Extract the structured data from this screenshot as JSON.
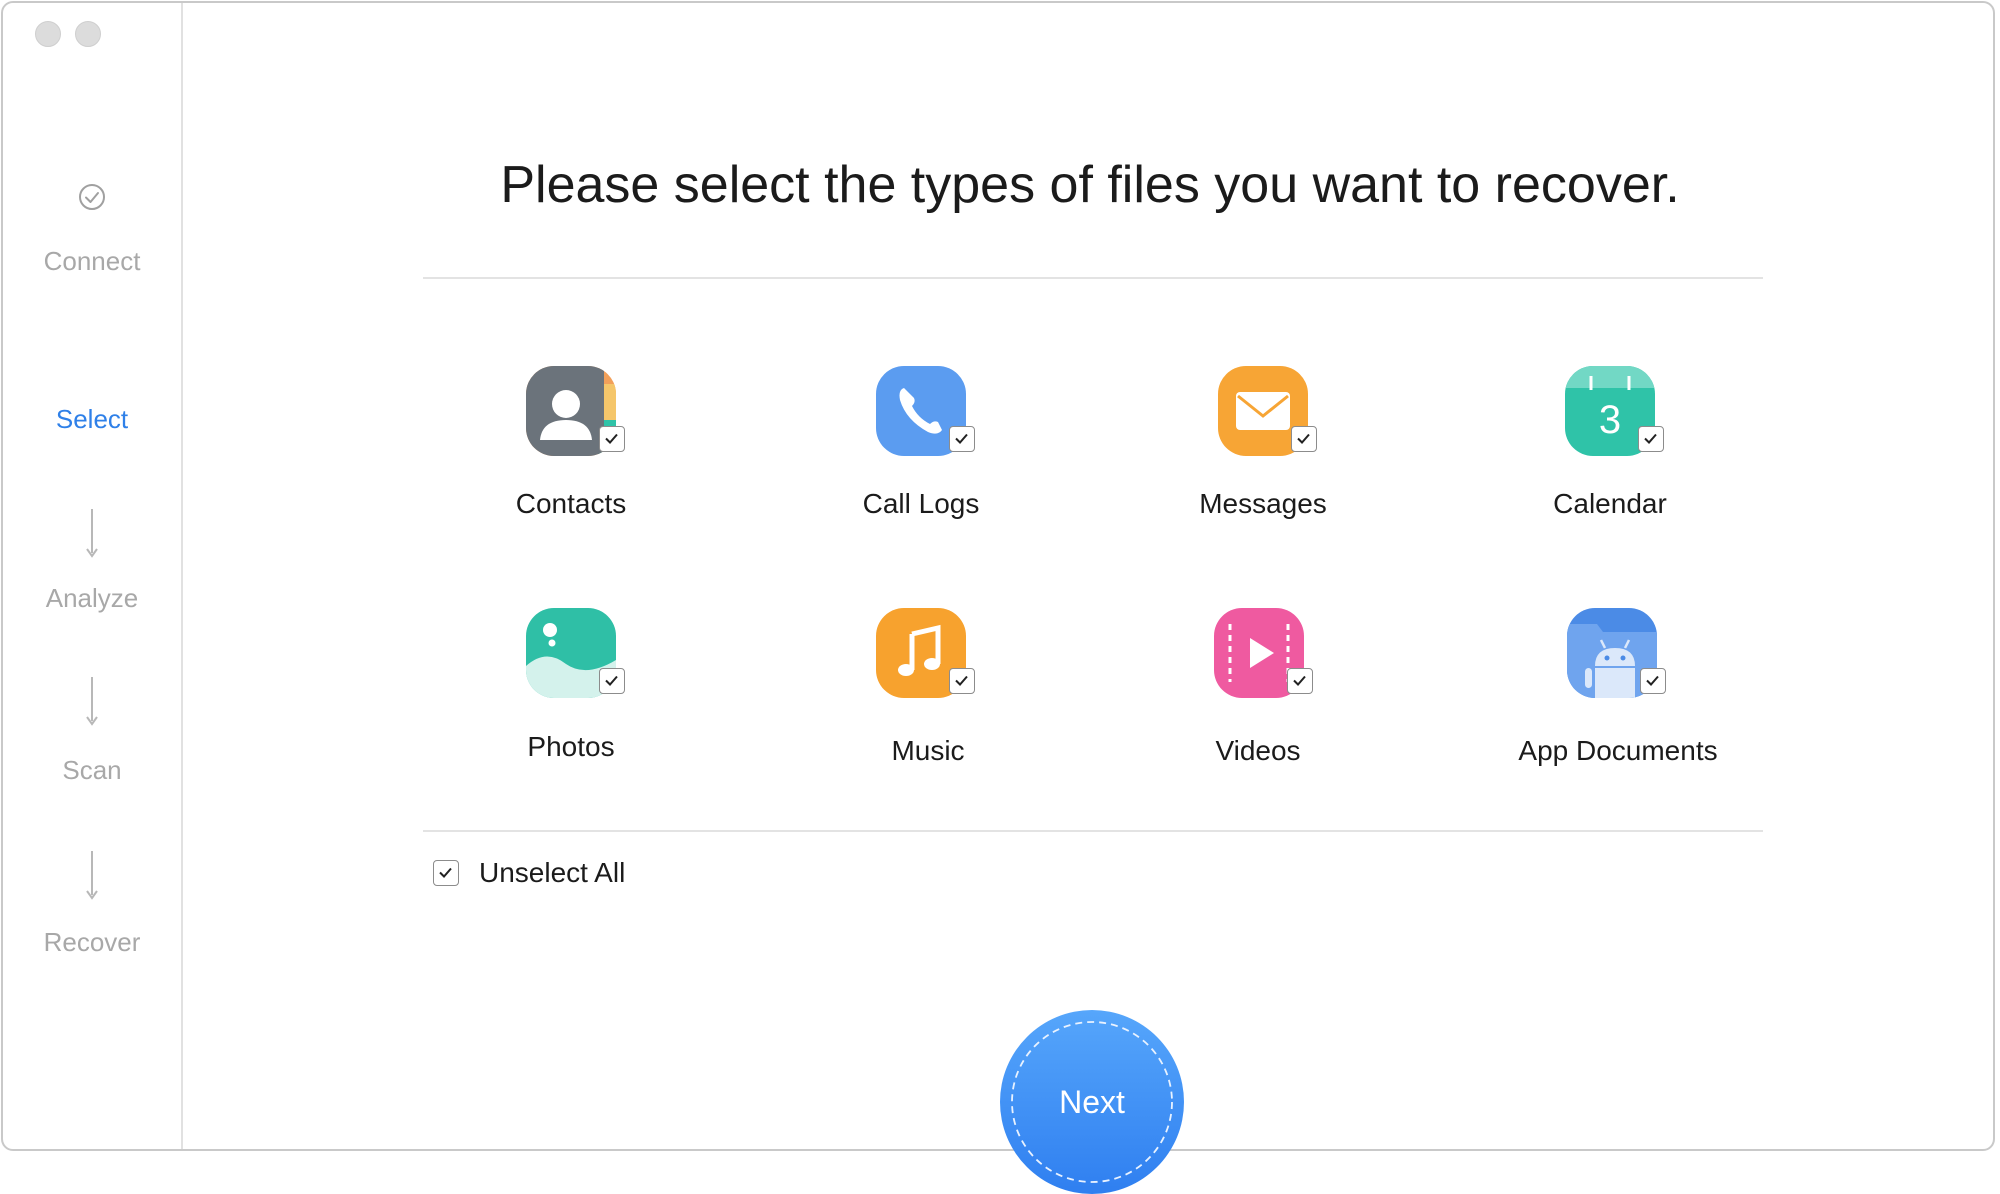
{
  "window": {
    "traffic_lights": [
      "close",
      "minimize"
    ]
  },
  "sidebar": {
    "steps": [
      {
        "label": "Connect",
        "state": "done",
        "icon": "check-circle-icon"
      },
      {
        "label": "Select",
        "state": "active"
      },
      {
        "label": "Analyze",
        "state": "pending",
        "icon": "arrow-down-icon"
      },
      {
        "label": "Scan",
        "state": "pending",
        "icon": "arrow-down-icon"
      },
      {
        "label": "Recover",
        "state": "pending",
        "icon": "arrow-down-icon"
      }
    ]
  },
  "main": {
    "title": "Please select the types of files you want to recover.",
    "file_types": [
      {
        "label": "Contacts",
        "icon": "contacts-icon",
        "checked": true
      },
      {
        "label": "Call Logs",
        "icon": "phone-icon",
        "checked": true
      },
      {
        "label": "Messages",
        "icon": "envelope-icon",
        "checked": true
      },
      {
        "label": "Calendar",
        "icon": "calendar-icon",
        "checked": true,
        "icon_text": "3"
      },
      {
        "label": "Photos",
        "icon": "photos-icon",
        "checked": true
      },
      {
        "label": "Music",
        "icon": "music-note-icon",
        "checked": true
      },
      {
        "label": "Videos",
        "icon": "play-icon",
        "checked": true
      },
      {
        "label": "App Documents",
        "icon": "android-icon",
        "checked": true
      }
    ],
    "unselect_all": {
      "label": "Unselect All",
      "checked": true
    },
    "next_button": {
      "label": "Next"
    }
  },
  "colors": {
    "accent": "#2f80e8",
    "inactive_text": "#a8a8a8",
    "next_button": "#3f8ff5",
    "contacts": "#6b737b",
    "call_logs": "#5b9cf0",
    "messages": "#f7a535",
    "calendar": "#2fc3a8",
    "photos": "#2fbfa6",
    "music": "#f7a22e",
    "videos": "#ef5aa0",
    "app_documents": "#4b8be6"
  }
}
